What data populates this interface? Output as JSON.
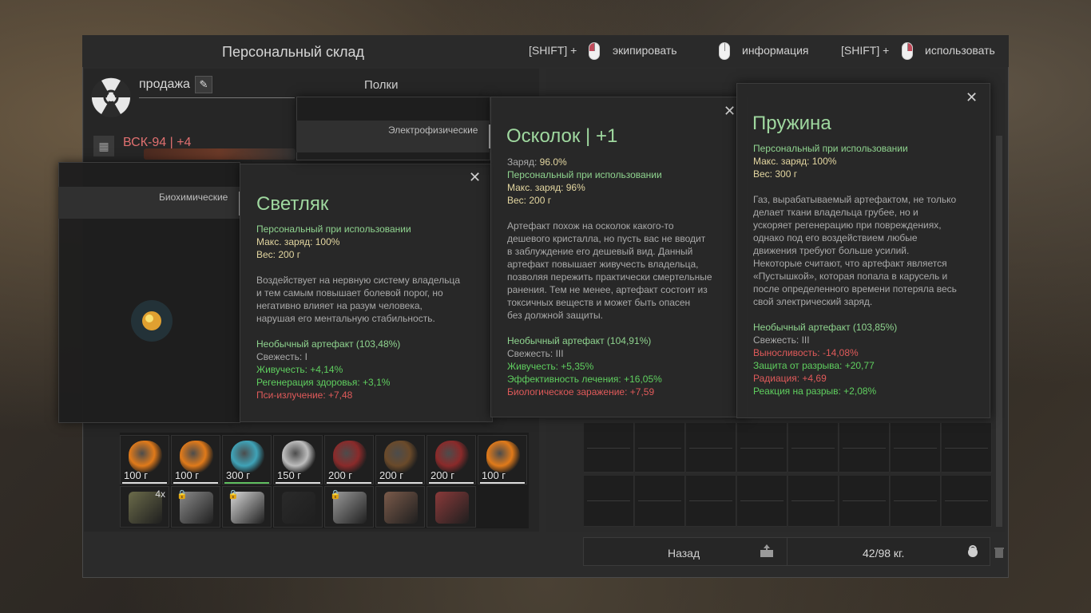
{
  "window": {
    "title": "Персональный склад",
    "hints": [
      {
        "prefix": "[SHIFT] +",
        "label": "экипировать",
        "button": "left"
      },
      {
        "prefix": "",
        "label": "информация",
        "button": "none"
      },
      {
        "prefix": "[SHIFT] +",
        "label": "использовать",
        "button": "right"
      }
    ]
  },
  "left": {
    "sale_label": "продажа",
    "shelves_label": "Полки",
    "weapon": "ВСК-94 | +4",
    "inventory_row1": [
      {
        "weight": "100 г",
        "color": "#e07a1a",
        "bar": "white"
      },
      {
        "weight": "100 г",
        "color": "#e07a1a",
        "bar": "white"
      },
      {
        "weight": "300 г",
        "color": "#3fa3b8",
        "bar": "green"
      },
      {
        "weight": "150 г",
        "color": "#bdbdbd",
        "bar": "white"
      },
      {
        "weight": "200 г",
        "color": "#8a2a2a",
        "bar": "white"
      },
      {
        "weight": "200 г",
        "color": "#6a4a2a",
        "bar": "white"
      },
      {
        "weight": "200 г",
        "color": "#8a2a2a",
        "bar": "white"
      },
      {
        "weight": "100 г",
        "color": "#e07a1a",
        "bar": "white"
      }
    ],
    "inventory_row2": [
      {
        "color": "#6b6b4a",
        "qty": "4x",
        "locked": false
      },
      {
        "color": "#8a8a8a",
        "qty": "",
        "locked": true
      },
      {
        "color": "#d8d8d8",
        "qty": "",
        "locked": true
      },
      {
        "color": "#2a2a2a",
        "qty": "",
        "locked": false
      },
      {
        "color": "#9a9a9a",
        "qty": "",
        "locked": true
      },
      {
        "color": "#7a5a4a",
        "qty": "",
        "locked": false
      },
      {
        "color": "#8a3a3a",
        "qty": "",
        "locked": false
      }
    ]
  },
  "footer": {
    "back_label": "Назад",
    "weight": "42/98 кг."
  },
  "tooltips": {
    "svetlyak": {
      "category": "Биохимические",
      "name": "Светляк",
      "lines": [
        {
          "t": "Персональный при использовании",
          "c": "green"
        },
        {
          "t": "Макс. заряд: 100%",
          "c": "yellow"
        },
        {
          "t": "Вес: 200 г",
          "c": "yellow"
        },
        {
          "t": "",
          "c": "grey"
        },
        {
          "t": "Воздействует на нервную систему владельца",
          "c": "grey"
        },
        {
          "t": "и тем самым повышает болевой порог, но",
          "c": "grey"
        },
        {
          "t": "негативно влияет на разум человека,",
          "c": "grey"
        },
        {
          "t": "нарушая его ментальную стабильность.",
          "c": "grey"
        },
        {
          "t": "",
          "c": "grey"
        },
        {
          "t": "Необычный артефакт (103,48%)",
          "c": "green"
        },
        {
          "t": "Свежесть: I",
          "c": "grey"
        },
        {
          "t": "Живучесть: +4,14%",
          "c": "plus"
        },
        {
          "t": "Регенерация здоровья: +3,1%",
          "c": "plus"
        },
        {
          "t": "Пси-излучение: +7,48",
          "c": "minus"
        }
      ]
    },
    "oskolok": {
      "category": "Электрофизические",
      "name": "Осколок | +1",
      "lines": [
        {
          "t": "Заряд: 96.0%",
          "c": "yellowlabel",
          "label": "Заряд: ",
          "value": "96.0%"
        },
        {
          "t": "Персональный при использовании",
          "c": "green"
        },
        {
          "t": "Макс. заряд: 96%",
          "c": "yellow"
        },
        {
          "t": "Вес: 200 г",
          "c": "yellow"
        },
        {
          "t": "",
          "c": "grey"
        },
        {
          "t": "Артефакт похож на осколок какого-то",
          "c": "grey"
        },
        {
          "t": "дешевого кристалла, но пусть вас не вводит",
          "c": "grey"
        },
        {
          "t": "в заблуждение его дешевый вид. Данный",
          "c": "grey"
        },
        {
          "t": "артефакт повышает живучесть владельца,",
          "c": "grey"
        },
        {
          "t": "позволяя пережить практически смертельные",
          "c": "grey"
        },
        {
          "t": "ранения. Тем не менее, артефакт состоит из",
          "c": "grey"
        },
        {
          "t": "токсичных веществ и может быть опасен",
          "c": "grey"
        },
        {
          "t": "без должной защиты.",
          "c": "grey"
        },
        {
          "t": "",
          "c": "grey"
        },
        {
          "t": "Необычный артефакт (104,91%)",
          "c": "green"
        },
        {
          "t": "Свежесть: III",
          "c": "grey"
        },
        {
          "t": "Живучесть: +5,35%",
          "c": "plus"
        },
        {
          "t": "Эффективность лечения: +16,05%",
          "c": "plus"
        },
        {
          "t": "Биологическое заражение: +7,59",
          "c": "minus"
        }
      ]
    },
    "pruzhina": {
      "name": "Пружина",
      "lines": [
        {
          "t": "Персональный при использовании",
          "c": "green"
        },
        {
          "t": "Макс. заряд: 100%",
          "c": "yellow"
        },
        {
          "t": "Вес: 300 г",
          "c": "yellow"
        },
        {
          "t": "",
          "c": "grey"
        },
        {
          "t": "Газ, вырабатываемый артефактом, не только",
          "c": "grey"
        },
        {
          "t": "делает ткани владельца грубее, но и",
          "c": "grey"
        },
        {
          "t": "ускоряет регенерацию при повреждениях,",
          "c": "grey"
        },
        {
          "t": "однако под его воздействием любые",
          "c": "grey"
        },
        {
          "t": "движения требуют больше усилий.",
          "c": "grey"
        },
        {
          "t": "Некоторые считают, что артефакт является",
          "c": "grey"
        },
        {
          "t": "«Пустышкой», которая попала в карусель и",
          "c": "grey"
        },
        {
          "t": "после определенного времени потеряла весь",
          "c": "grey"
        },
        {
          "t": "свой электрический заряд.",
          "c": "grey"
        },
        {
          "t": "",
          "c": "grey"
        },
        {
          "t": "Необычный артефакт (103,85%)",
          "c": "green"
        },
        {
          "t": "Свежесть: III",
          "c": "grey"
        },
        {
          "t": "Выносливость: -14,08%",
          "c": "minus"
        },
        {
          "t": "Защита от разрыва: +20,77",
          "c": "plus"
        },
        {
          "t": "Радиация: +4,69",
          "c": "minus"
        },
        {
          "t": "Реакция на разрыв: +2,08%",
          "c": "plus"
        }
      ]
    }
  }
}
